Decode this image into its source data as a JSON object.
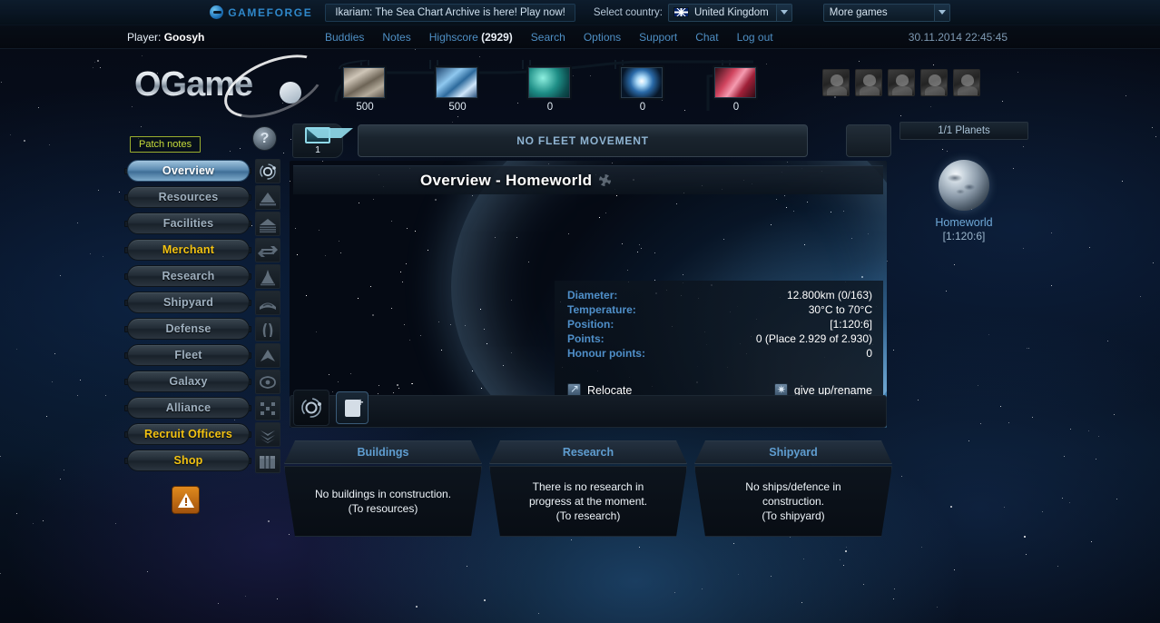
{
  "gameforge": {
    "brand": "GAMEFORGE",
    "promo": "Ikariam: The Sea Chart Archive is here! Play now!",
    "country_label": "Select country:",
    "country_value": "United Kingdom",
    "more_games": "More games"
  },
  "player": {
    "label": "Player:",
    "name": "Goosyh",
    "server_time": "30.11.2014 22:45:45"
  },
  "top_nav": [
    {
      "label": "Buddies",
      "count": ""
    },
    {
      "label": "Notes",
      "count": ""
    },
    {
      "label": "Highscore",
      "count": "(2929)"
    },
    {
      "label": "Search",
      "count": ""
    },
    {
      "label": "Options",
      "count": ""
    },
    {
      "label": "Support",
      "count": ""
    },
    {
      "label": "Chat",
      "count": ""
    },
    {
      "label": "Log out",
      "count": ""
    }
  ],
  "logo": {
    "text": "OGame"
  },
  "resources": [
    {
      "name": "metal",
      "value": "500"
    },
    {
      "name": "crystal",
      "value": "500"
    },
    {
      "name": "deuterium",
      "value": "0"
    },
    {
      "name": "energy",
      "value": "0"
    },
    {
      "name": "darkmatter",
      "value": "0"
    }
  ],
  "officers": [
    "commander",
    "admiral",
    "engineer",
    "geologist",
    "technocrat"
  ],
  "patch_notes": "Patch notes",
  "help": "?",
  "menu": [
    {
      "label": "Overview",
      "state": "selected",
      "icon": "overview-icon"
    },
    {
      "label": "Resources",
      "state": "normal",
      "icon": "resources-icon"
    },
    {
      "label": "Facilities",
      "state": "normal",
      "icon": "facilities-icon"
    },
    {
      "label": "Merchant",
      "state": "gold",
      "icon": "merchant-icon"
    },
    {
      "label": "Research",
      "state": "normal",
      "icon": "research-icon"
    },
    {
      "label": "Shipyard",
      "state": "normal",
      "icon": "shipyard-icon"
    },
    {
      "label": "Defense",
      "state": "normal",
      "icon": "defense-icon"
    },
    {
      "label": "Fleet",
      "state": "normal",
      "icon": "fleet-icon"
    },
    {
      "label": "Galaxy",
      "state": "normal",
      "icon": "galaxy-icon"
    },
    {
      "label": "Alliance",
      "state": "normal",
      "icon": "alliance-icon"
    },
    {
      "label": "Recruit Officers",
      "state": "gold",
      "icon": "officers-icon"
    },
    {
      "label": "Shop",
      "state": "gold",
      "icon": "shop-icon"
    }
  ],
  "fleet": {
    "mail_count": "1",
    "status": "NO FLEET MOVEMENT"
  },
  "page": {
    "title": "Overview - Homeworld"
  },
  "planet_info": {
    "rows": [
      {
        "key": "Diameter:",
        "value": "12.800km (0/163)"
      },
      {
        "key": "Temperature:",
        "value": "30°C to 70°C"
      },
      {
        "key": "Position:",
        "value": "[1:120:6]"
      },
      {
        "key": "Points:",
        "value": "0 (Place 2.929 of 2.930)"
      },
      {
        "key": "Honour points:",
        "value": "0"
      }
    ],
    "relocate": "Relocate",
    "giveup": "give up/rename"
  },
  "panels": [
    {
      "title": "Buildings",
      "text": "No buildings in construction.\n(To resources)"
    },
    {
      "title": "Research",
      "text": "There is no research in\nprogress at the moment.\n(To research)"
    },
    {
      "title": "Shipyard",
      "text": "No ships/defence in\nconstruction.\n(To shipyard)"
    }
  ],
  "planet_list": {
    "count": "1/1 Planets",
    "name": "Homeworld",
    "coords": "[1:120:6]"
  },
  "colors": {
    "accent_blue": "#4f8fc9",
    "gold": "#f2c213",
    "panel_title": "#5f9dd0",
    "warning": "#e08a1e"
  }
}
